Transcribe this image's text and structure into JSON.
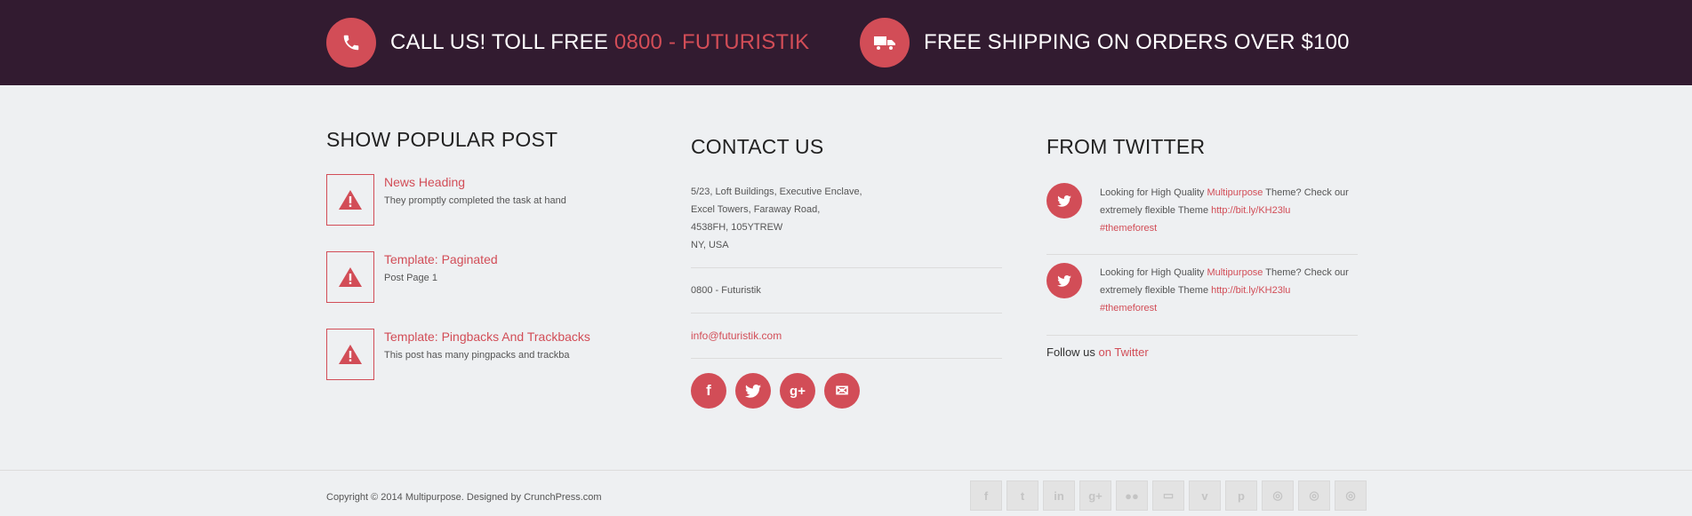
{
  "topbar": {
    "call": {
      "prefix": "CALL US! TOLL FREE",
      "number": "0800 - FUTURISTIK"
    },
    "shipping": "FREE SHIPPING ON ORDERS OVER $100"
  },
  "popular": {
    "heading": "SHOW POPULAR POST",
    "posts": [
      {
        "title": "News Heading",
        "excerpt": "They promptly completed the task at hand"
      },
      {
        "title": "Template: Paginated",
        "excerpt": "Post Page 1"
      },
      {
        "title": "Template: Pingbacks And Trackbacks",
        "excerpt": "This post has many pingpacks and trackba"
      }
    ]
  },
  "contact": {
    "heading": "CONTACT US",
    "address": [
      "5/23, Loft Buildings, Executive Enclave,",
      "Excel Towers, Faraway Road,",
      "4538FH, 105YTREW",
      "NY, USA"
    ],
    "phone": "0800 - Futuristik",
    "email": "info@futuristik.com",
    "social": [
      {
        "icon": "facebook-icon",
        "glyph": "f"
      },
      {
        "icon": "twitter-icon",
        "glyph": "t"
      },
      {
        "icon": "google-plus-icon",
        "glyph": "g+"
      },
      {
        "icon": "email-icon",
        "glyph": "✉"
      }
    ]
  },
  "twitter": {
    "heading": "FROM TWITTER",
    "tweets": [
      {
        "pre": "Looking for High Quality ",
        "link1": "Multipurpose",
        "mid": " Theme? Check our extremely flexible Theme ",
        "link2": "http://bit.ly/KH23lu",
        "tag": "#themeforest"
      },
      {
        "pre": "Looking for High Quality ",
        "link1": "Multipurpose",
        "mid": " Theme? Check our extremely flexible Theme ",
        "link2": "http://bit.ly/KH23lu",
        "tag": "#themeforest"
      }
    ],
    "follow_prefix": "Follow us",
    "follow_link": "on Twitter"
  },
  "footer": {
    "copyright": "Copyright © 2014 Multipurpose. Designed by CrunchPress.com",
    "icons": [
      {
        "name": "facebook-icon",
        "glyph": "f"
      },
      {
        "name": "twitter-icon",
        "glyph": "t"
      },
      {
        "name": "linkedin-icon",
        "glyph": "in"
      },
      {
        "name": "google-plus-icon",
        "glyph": "g+"
      },
      {
        "name": "flickr-icon",
        "glyph": "●●"
      },
      {
        "name": "youtube-icon",
        "glyph": "▭"
      },
      {
        "name": "vimeo-icon",
        "glyph": "v"
      },
      {
        "name": "pinterest-icon",
        "glyph": "p"
      },
      {
        "name": "instagram-icon",
        "glyph": "◎"
      },
      {
        "name": "dribbble-icon",
        "glyph": "◎"
      },
      {
        "name": "rss-icon",
        "glyph": "◎"
      }
    ]
  },
  "colors": {
    "accent": "#d24d57",
    "topbar": "#321b30",
    "background": "#eef0f2"
  }
}
